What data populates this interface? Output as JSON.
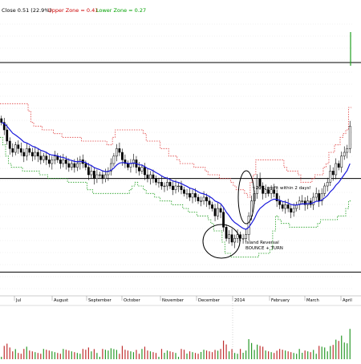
{
  "chart_data": {
    "type": "candlestick",
    "header": {
      "close_label": "Close 0.51 (22.9%)",
      "upper_zone_label": "Upper Zone = 0.41",
      "lower_zone_label": "Lower Zone = 0.27"
    },
    "months": [
      "Jul",
      "August",
      "September",
      "October",
      "November",
      "December",
      "2014",
      "February",
      "March",
      "April"
    ],
    "annotations": {
      "profit_note": "~20% profit within 2 days!",
      "reversal_line1": "Island Reversal",
      "reversal_line2": "BOUNCE + TURN"
    },
    "horizontal_levels": [
      0.68,
      0.37,
      0.12
    ],
    "ylim": [
      0.05,
      0.8
    ],
    "series": [
      {
        "close": [
          0.52,
          0.5,
          0.47,
          0.45,
          0.44,
          0.46,
          0.45,
          0.44,
          0.43,
          0.45,
          0.44,
          0.43,
          0.44,
          0.43,
          0.42,
          0.43,
          0.42,
          0.41,
          0.42,
          0.43,
          0.42,
          0.41,
          0.42,
          0.41,
          0.4,
          0.41,
          0.4,
          0.41,
          0.42,
          0.41,
          0.4,
          0.38,
          0.39,
          0.37,
          0.38,
          0.38,
          0.37,
          0.38,
          0.39,
          0.41,
          0.43,
          0.45,
          0.44,
          0.42,
          0.41,
          0.4,
          0.41,
          0.42,
          0.4,
          0.39,
          0.4,
          0.38,
          0.37,
          0.38,
          0.37,
          0.36,
          0.36,
          0.35,
          0.35,
          0.36,
          0.35,
          0.34,
          0.35,
          0.35,
          0.34,
          0.33,
          0.33,
          0.32,
          0.33,
          0.32,
          0.31,
          0.31,
          0.32,
          0.31,
          0.3,
          0.29,
          0.27,
          0.29,
          0.28,
          0.24,
          0.21,
          0.22,
          0.2,
          0.21,
          0.22,
          0.21,
          0.21,
          0.22,
          0.27,
          0.31,
          0.33,
          0.37,
          0.35,
          0.33,
          0.34,
          0.33,
          0.34,
          0.33,
          0.31,
          0.3,
          0.29,
          0.3,
          0.29,
          0.28,
          0.29,
          0.3,
          0.31,
          0.31,
          0.3,
          0.31,
          0.3,
          0.32,
          0.33,
          0.31,
          0.33,
          0.35,
          0.36,
          0.39,
          0.38,
          0.41,
          0.4,
          0.43,
          0.44,
          0.45,
          0.51
        ]
      }
    ]
  }
}
